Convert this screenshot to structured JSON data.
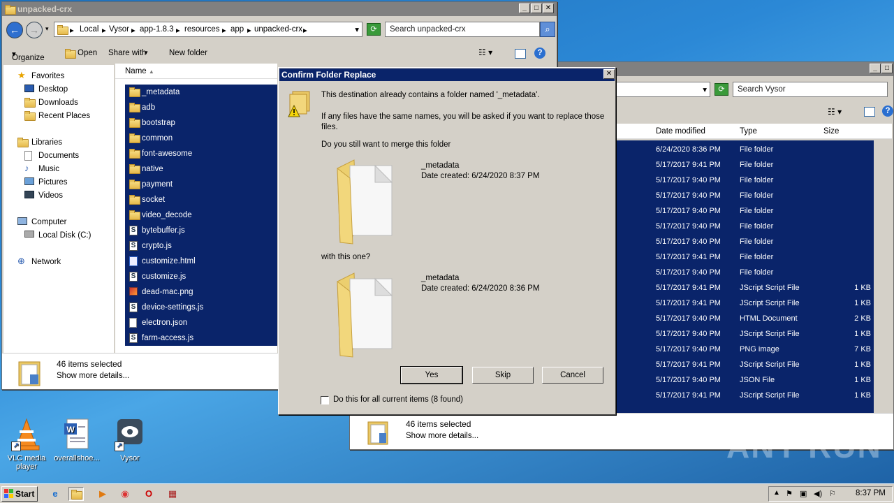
{
  "left_window": {
    "title": "unpacked-crx",
    "breadcrumb": [
      "Local",
      "Vysor",
      "app-1.8.3",
      "resources",
      "app",
      "unpacked-crx"
    ],
    "search_placeholder": "Search unpacked-crx",
    "toolbar": {
      "organize": "Organize",
      "open": "Open",
      "share_with": "Share with",
      "new_folder": "New folder"
    },
    "nav": {
      "favorites": "Favorites",
      "desktop": "Desktop",
      "downloads": "Downloads",
      "recent_places": "Recent Places",
      "libraries": "Libraries",
      "documents": "Documents",
      "music": "Music",
      "pictures": "Pictures",
      "videos": "Videos",
      "computer": "Computer",
      "local_disk": "Local Disk (C:)",
      "network": "Network"
    },
    "column_name": "Name",
    "files": [
      {
        "name": "_metadata",
        "kind": "folder"
      },
      {
        "name": "adb",
        "kind": "folder"
      },
      {
        "name": "bootstrap",
        "kind": "folder"
      },
      {
        "name": "common",
        "kind": "folder"
      },
      {
        "name": "font-awesome",
        "kind": "folder"
      },
      {
        "name": "native",
        "kind": "folder"
      },
      {
        "name": "payment",
        "kind": "folder"
      },
      {
        "name": "socket",
        "kind": "folder"
      },
      {
        "name": "video_decode",
        "kind": "folder"
      },
      {
        "name": "bytebuffer.js",
        "kind": "js"
      },
      {
        "name": "crypto.js",
        "kind": "js"
      },
      {
        "name": "customize.html",
        "kind": "html"
      },
      {
        "name": "customize.js",
        "kind": "js"
      },
      {
        "name": "dead-mac.png",
        "kind": "png"
      },
      {
        "name": "device-settings.js",
        "kind": "js"
      },
      {
        "name": "electron.json",
        "kind": "doc"
      },
      {
        "name": "farm-access.js",
        "kind": "js"
      }
    ],
    "status_selected": "46 items selected",
    "status_details": "Show more details..."
  },
  "right_window": {
    "search_placeholder": "Search Vysor",
    "columns": [
      "Date modified",
      "Type",
      "Size"
    ],
    "rows": [
      {
        "date": "6/24/2020 8:36 PM",
        "type": "File folder",
        "size": ""
      },
      {
        "date": "5/17/2017 9:41 PM",
        "type": "File folder",
        "size": ""
      },
      {
        "date": "5/17/2017 9:40 PM",
        "type": "File folder",
        "size": ""
      },
      {
        "date": "5/17/2017 9:40 PM",
        "type": "File folder",
        "size": ""
      },
      {
        "date": "5/17/2017 9:40 PM",
        "type": "File folder",
        "size": ""
      },
      {
        "date": "5/17/2017 9:40 PM",
        "type": "File folder",
        "size": ""
      },
      {
        "date": "5/17/2017 9:40 PM",
        "type": "File folder",
        "size": ""
      },
      {
        "date": "5/17/2017 9:41 PM",
        "type": "File folder",
        "size": ""
      },
      {
        "date": "5/17/2017 9:40 PM",
        "type": "File folder",
        "size": ""
      },
      {
        "date": "5/17/2017 9:41 PM",
        "type": "JScript Script File",
        "size": "1 KB"
      },
      {
        "date": "5/17/2017 9:41 PM",
        "type": "JScript Script File",
        "size": "1 KB"
      },
      {
        "date": "5/17/2017 9:40 PM",
        "type": "HTML Document",
        "size": "2 KB"
      },
      {
        "date": "5/17/2017 9:40 PM",
        "type": "JScript Script File",
        "size": "1 KB"
      },
      {
        "date": "5/17/2017 9:40 PM",
        "type": "PNG image",
        "size": "7 KB"
      },
      {
        "date": "5/17/2017 9:41 PM",
        "type": "JScript Script File",
        "size": "1 KB"
      },
      {
        "date": "5/17/2017 9:40 PM",
        "type": "JSON File",
        "size": "1 KB"
      },
      {
        "date": "5/17/2017 9:41 PM",
        "type": "JScript Script File",
        "size": "1 KB"
      }
    ],
    "status_selected": "46 items selected",
    "status_details": "Show more details..."
  },
  "dialog": {
    "title": "Confirm Folder Replace",
    "message": "This destination already contains a folder named '_metadata'.",
    "note": "If any files have the same names, you will be asked if you want to replace those files.",
    "question": "Do you still want to merge this folder",
    "existing": {
      "name": "_metadata",
      "date": "Date created: 6/24/2020 8:37 PM"
    },
    "with_label": "with this one?",
    "incoming": {
      "name": "_metadata",
      "date": "Date created: 6/24/2020 8:36 PM"
    },
    "yes": "Yes",
    "skip": "Skip",
    "cancel": "Cancel",
    "checkbox_label": "Do this for all current items (8 found)",
    "checkbox_checked": false
  },
  "desktop_icons": [
    {
      "label": "VLC media player",
      "icon": "vlc-icon"
    },
    {
      "label": "overallshoe...",
      "icon": "word-document-icon"
    },
    {
      "label": "Vysor",
      "icon": "vysor-icon"
    }
  ],
  "taskbar": {
    "start": "Start",
    "clock": "8:37 PM"
  },
  "watermark": "ANY RUN"
}
